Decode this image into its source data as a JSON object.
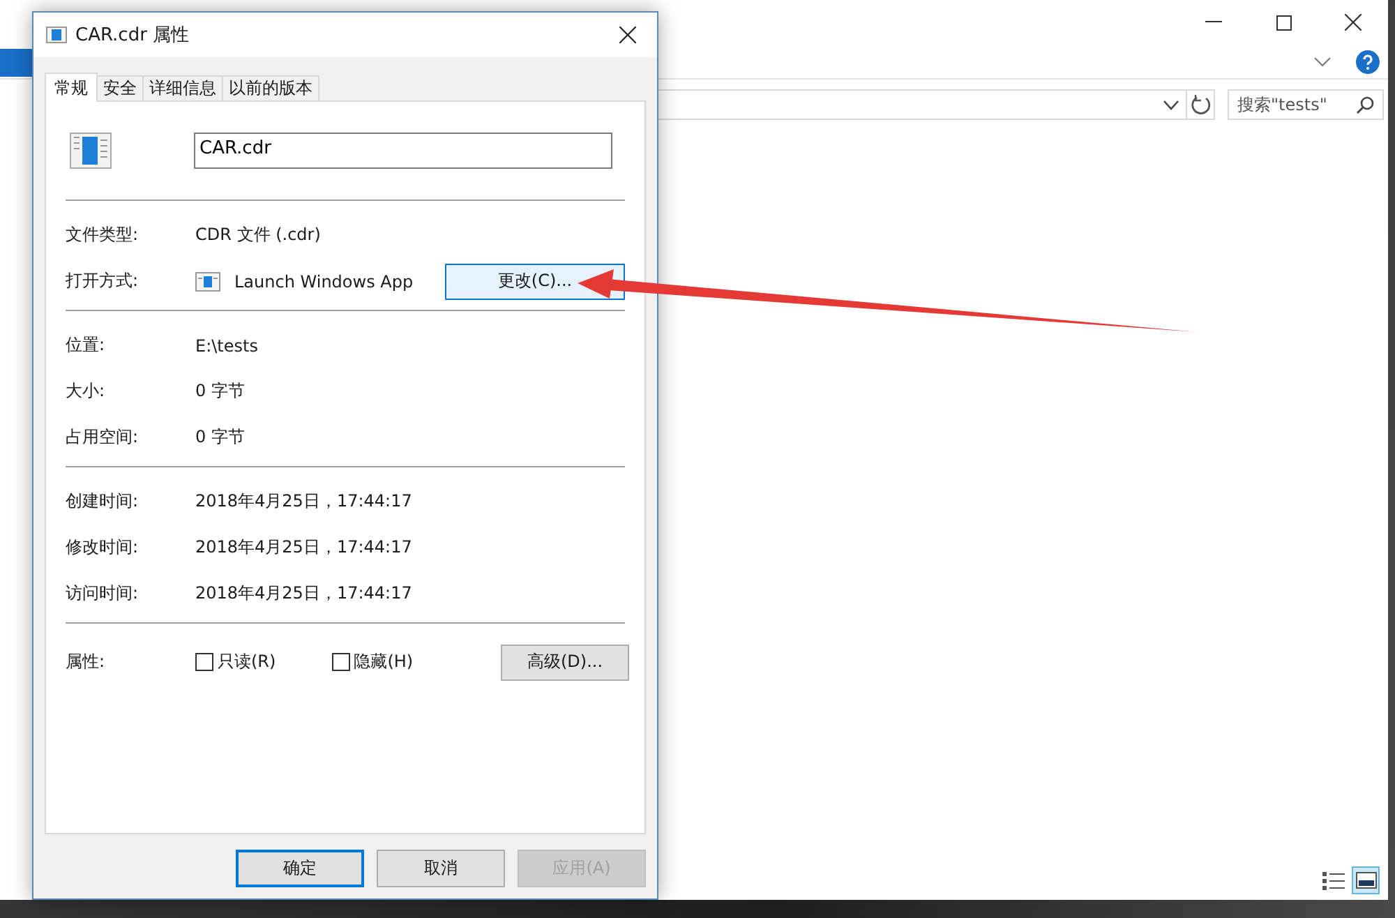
{
  "explorer": {
    "search": {
      "placeholder": "搜索\"tests\""
    },
    "view_buttons": [
      {
        "kind": "details",
        "selected": false
      },
      {
        "kind": "large_icons",
        "selected": true
      }
    ]
  },
  "dialog": {
    "title": "CAR.cdr 属性",
    "tabs": [
      {
        "label": "常规",
        "selected": true
      },
      {
        "label": "安全",
        "selected": false
      },
      {
        "label": "详细信息",
        "selected": false
      },
      {
        "label": "以前的版本",
        "selected": false
      }
    ],
    "file_name": "CAR.cdr",
    "sections": [
      [
        {
          "label": "文件类型:",
          "value": "CDR 文件 (.cdr)"
        },
        {
          "label": "打开方式:",
          "value": "Launch Windows App",
          "app_icon": true,
          "button": "更改(C)..."
        }
      ],
      [
        {
          "label": "位置:",
          "value": "E:\\tests"
        },
        {
          "label": "大小:",
          "value": "0 字节"
        },
        {
          "label": "占用空间:",
          "value": "0 字节"
        }
      ],
      [
        {
          "label": "创建时间:",
          "value": "2018年4月25日，17:44:17"
        },
        {
          "label": "修改时间:",
          "value": "2018年4月25日，17:44:17"
        },
        {
          "label": "访问时间:",
          "value": "2018年4月25日，17:44:17"
        }
      ]
    ],
    "attributes": {
      "label": "属性:",
      "checkboxes": [
        {
          "label": "只读(R)",
          "checked": false
        },
        {
          "label": "隐藏(H)",
          "checked": false
        }
      ],
      "button": "高级(D)..."
    },
    "buttons": [
      {
        "label": "确定",
        "default": true,
        "disabled": false
      },
      {
        "label": "取消",
        "default": false,
        "disabled": false
      },
      {
        "label": "应用(A)",
        "default": false,
        "disabled": true
      }
    ]
  }
}
